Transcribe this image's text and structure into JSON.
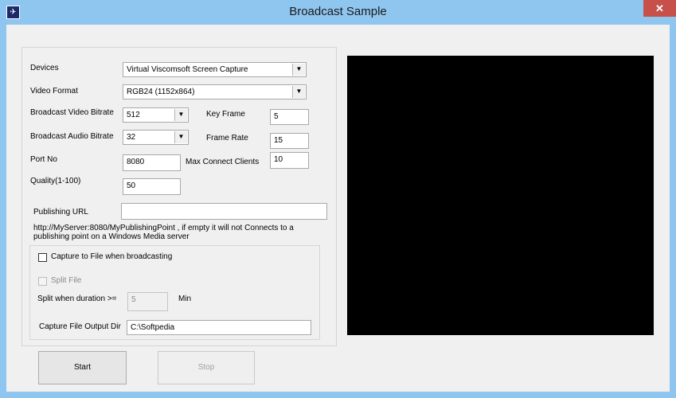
{
  "window": {
    "title": "Broadcast Sample",
    "close_glyph": "✕",
    "app_icon_glyph": "✈"
  },
  "form": {
    "devices": {
      "label": "Devices",
      "value": "Virtual Viscomsoft Screen Capture"
    },
    "video_format": {
      "label": "Video Format",
      "value": "RGB24 (1152x864)"
    },
    "video_bitrate": {
      "label": "Broadcast Video Bitrate",
      "value": "512"
    },
    "key_frame": {
      "label": "Key Frame",
      "value": "5"
    },
    "audio_bitrate": {
      "label": "Broadcast Audio Bitrate",
      "value": "32"
    },
    "frame_rate": {
      "label": "Frame Rate",
      "value": "15"
    },
    "port_no": {
      "label": "Port No",
      "value": "8080"
    },
    "max_clients": {
      "label": "Max Connect Clients",
      "value": "10"
    },
    "quality": {
      "label": "Quality(1-100)",
      "value": "50"
    },
    "publishing_url": {
      "label": "Publishing URL",
      "value": ""
    },
    "hint_line1": "http://MyServer:8080/MyPublishingPoint , if empty it will not Connects to a",
    "hint_line2": "publishing point on a Windows Media server"
  },
  "capture": {
    "capture_to_file": {
      "label": "Capture to File when broadcasting",
      "checked": false
    },
    "split_file": {
      "label": "Split File",
      "checked": false,
      "enabled": false
    },
    "split_duration": {
      "label": "Split when duration >=",
      "value": "5",
      "unit": "Min"
    },
    "output_dir": {
      "label": "Capture File Output Dir",
      "value": "C:\\Softpedia"
    }
  },
  "buttons": {
    "start": "Start",
    "stop": "Stop"
  },
  "combo_arrow_glyph": "▼"
}
